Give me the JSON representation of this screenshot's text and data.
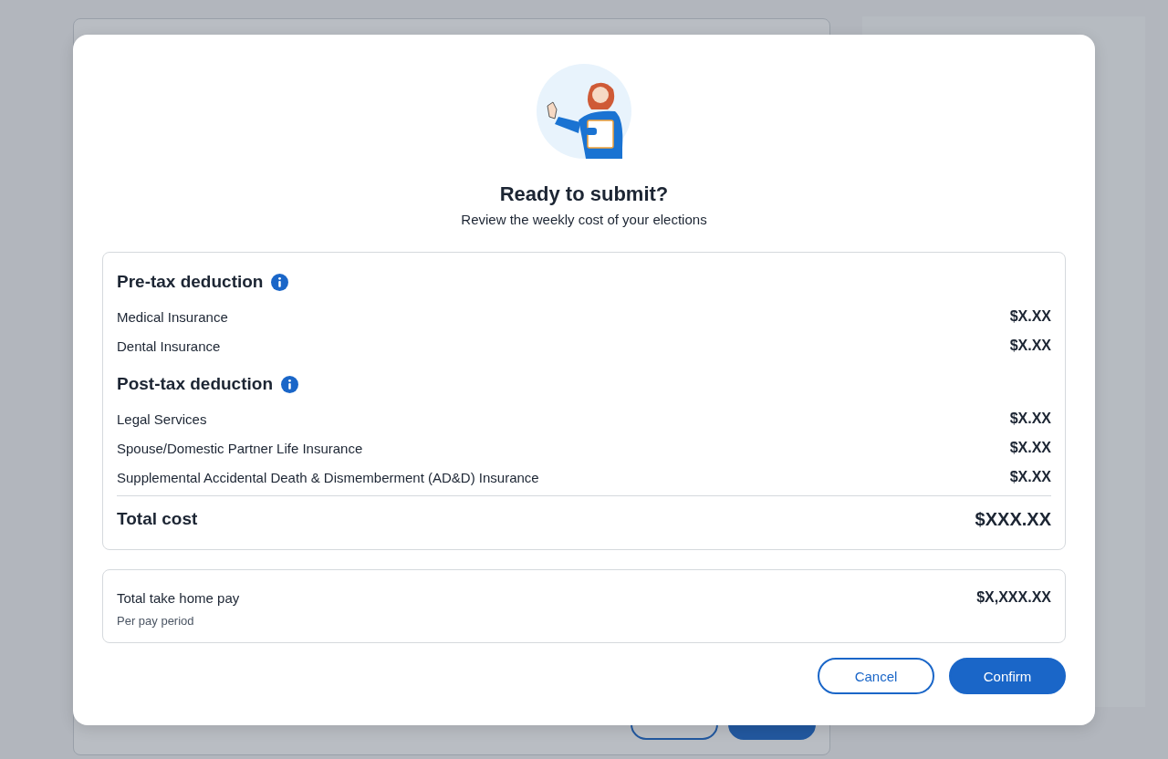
{
  "background_page": {
    "buttons": [
      {
        "kind": "secondary"
      },
      {
        "kind": "primary"
      }
    ]
  },
  "dialog": {
    "title": "Ready to submit?",
    "subtitle": "Review the weekly cost of your elections",
    "sections": [
      {
        "heading": "Pre-tax deduction",
        "info_icon": true,
        "items": [
          {
            "label": "Medical Insurance",
            "amount": "$X.XX"
          },
          {
            "label": "Dental Insurance",
            "amount": "$X.XX"
          }
        ]
      },
      {
        "heading": "Post-tax deduction",
        "info_icon": true,
        "items": [
          {
            "label": "Legal Services",
            "amount": "$X.XX"
          },
          {
            "label": "Spouse/Domestic Partner Life Insurance",
            "amount": "$X.XX"
          },
          {
            "label": "Supplemental Accidental Death & Dismemberment (AD&D) Insurance",
            "amount": "$X.XX"
          }
        ]
      }
    ],
    "total": {
      "label": "Total cost",
      "amount": "$XXX.XX"
    },
    "take_home": {
      "label": "Total take home pay",
      "amount": "$X,XXX.XX",
      "note": "Per pay period"
    },
    "buttons": [
      {
        "label": "Cancel",
        "kind": "secondary"
      },
      {
        "label": "Confirm",
        "kind": "primary"
      }
    ]
  }
}
